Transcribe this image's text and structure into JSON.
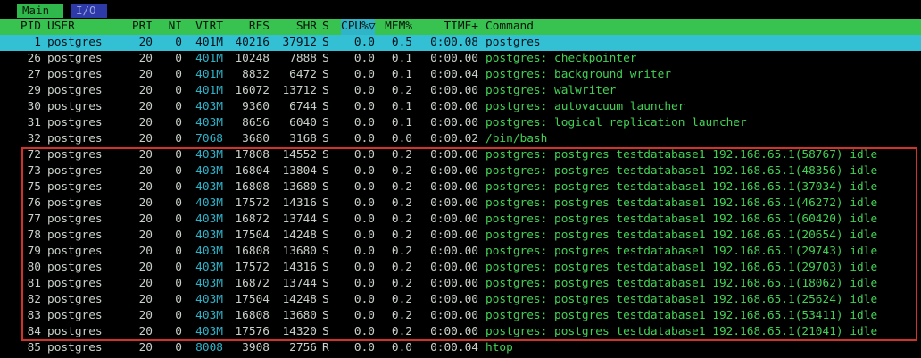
{
  "tabs": [
    {
      "label": "Main"
    },
    {
      "label": "I/O"
    }
  ],
  "header": {
    "pid": "PID",
    "user": "USER",
    "pri": "PRI",
    "ni": "NI",
    "virt": "VIRT",
    "res": "RES",
    "shr": "SHR",
    "s": "S",
    "cpu": "CPU%",
    "sort_marker": "▽",
    "mem": "MEM%",
    "time": "TIME+",
    "command": "Command"
  },
  "colors": {
    "header_bg": "#38c24f",
    "selected_bg": "#33bfd4",
    "highlight_border": "#d33228"
  },
  "processes": [
    {
      "pid": "1",
      "user": "postgres",
      "pri": "20",
      "ni": "0",
      "virt": "401M",
      "res": "40216",
      "shr": "37912",
      "s": "S",
      "cpu": "0.0",
      "mem": "0.5",
      "time": "0:00.08",
      "command": "postgres",
      "selected": true
    },
    {
      "pid": "26",
      "user": "postgres",
      "pri": "20",
      "ni": "0",
      "virt": "401M",
      "res": "10248",
      "shr": "7888",
      "s": "S",
      "cpu": "0.0",
      "mem": "0.1",
      "time": "0:00.00",
      "command": "postgres: checkpointer"
    },
    {
      "pid": "27",
      "user": "postgres",
      "pri": "20",
      "ni": "0",
      "virt": "401M",
      "res": "8832",
      "shr": "6472",
      "s": "S",
      "cpu": "0.0",
      "mem": "0.1",
      "time": "0:00.04",
      "command": "postgres: background writer"
    },
    {
      "pid": "29",
      "user": "postgres",
      "pri": "20",
      "ni": "0",
      "virt": "401M",
      "res": "16072",
      "shr": "13712",
      "s": "S",
      "cpu": "0.0",
      "mem": "0.2",
      "time": "0:00.00",
      "command": "postgres: walwriter"
    },
    {
      "pid": "30",
      "user": "postgres",
      "pri": "20",
      "ni": "0",
      "virt": "403M",
      "res": "9360",
      "shr": "6744",
      "s": "S",
      "cpu": "0.0",
      "mem": "0.1",
      "time": "0:00.00",
      "command": "postgres: autovacuum launcher"
    },
    {
      "pid": "31",
      "user": "postgres",
      "pri": "20",
      "ni": "0",
      "virt": "403M",
      "res": "8656",
      "shr": "6040",
      "s": "S",
      "cpu": "0.0",
      "mem": "0.1",
      "time": "0:00.00",
      "command": "postgres: logical replication launcher"
    },
    {
      "pid": "32",
      "user": "postgres",
      "pri": "20",
      "ni": "0",
      "virt": "7068",
      "res": "3680",
      "shr": "3168",
      "s": "S",
      "cpu": "0.0",
      "mem": "0.0",
      "time": "0:00.02",
      "command": "/bin/bash"
    },
    {
      "pid": "72",
      "user": "postgres",
      "pri": "20",
      "ni": "0",
      "virt": "403M",
      "res": "17808",
      "shr": "14552",
      "s": "S",
      "cpu": "0.0",
      "mem": "0.2",
      "time": "0:00.00",
      "command": "postgres: postgres testdatabase1 192.168.65.1(58767) idle"
    },
    {
      "pid": "73",
      "user": "postgres",
      "pri": "20",
      "ni": "0",
      "virt": "403M",
      "res": "16804",
      "shr": "13804",
      "s": "S",
      "cpu": "0.0",
      "mem": "0.2",
      "time": "0:00.00",
      "command": "postgres: postgres testdatabase1 192.168.65.1(48356) idle"
    },
    {
      "pid": "75",
      "user": "postgres",
      "pri": "20",
      "ni": "0",
      "virt": "403M",
      "res": "16808",
      "shr": "13680",
      "s": "S",
      "cpu": "0.0",
      "mem": "0.2",
      "time": "0:00.00",
      "command": "postgres: postgres testdatabase1 192.168.65.1(37034) idle"
    },
    {
      "pid": "76",
      "user": "postgres",
      "pri": "20",
      "ni": "0",
      "virt": "403M",
      "res": "17572",
      "shr": "14316",
      "s": "S",
      "cpu": "0.0",
      "mem": "0.2",
      "time": "0:00.00",
      "command": "postgres: postgres testdatabase1 192.168.65.1(46272) idle"
    },
    {
      "pid": "77",
      "user": "postgres",
      "pri": "20",
      "ni": "0",
      "virt": "403M",
      "res": "16872",
      "shr": "13744",
      "s": "S",
      "cpu": "0.0",
      "mem": "0.2",
      "time": "0:00.00",
      "command": "postgres: postgres testdatabase1 192.168.65.1(60420) idle"
    },
    {
      "pid": "78",
      "user": "postgres",
      "pri": "20",
      "ni": "0",
      "virt": "403M",
      "res": "17504",
      "shr": "14248",
      "s": "S",
      "cpu": "0.0",
      "mem": "0.2",
      "time": "0:00.00",
      "command": "postgres: postgres testdatabase1 192.168.65.1(20654) idle"
    },
    {
      "pid": "79",
      "user": "postgres",
      "pri": "20",
      "ni": "0",
      "virt": "403M",
      "res": "16808",
      "shr": "13680",
      "s": "S",
      "cpu": "0.0",
      "mem": "0.2",
      "time": "0:00.00",
      "command": "postgres: postgres testdatabase1 192.168.65.1(29743) idle"
    },
    {
      "pid": "80",
      "user": "postgres",
      "pri": "20",
      "ni": "0",
      "virt": "403M",
      "res": "17572",
      "shr": "14316",
      "s": "S",
      "cpu": "0.0",
      "mem": "0.2",
      "time": "0:00.00",
      "command": "postgres: postgres testdatabase1 192.168.65.1(29703) idle"
    },
    {
      "pid": "81",
      "user": "postgres",
      "pri": "20",
      "ni": "0",
      "virt": "403M",
      "res": "16872",
      "shr": "13744",
      "s": "S",
      "cpu": "0.0",
      "mem": "0.2",
      "time": "0:00.00",
      "command": "postgres: postgres testdatabase1 192.168.65.1(18062) idle"
    },
    {
      "pid": "82",
      "user": "postgres",
      "pri": "20",
      "ni": "0",
      "virt": "403M",
      "res": "17504",
      "shr": "14248",
      "s": "S",
      "cpu": "0.0",
      "mem": "0.2",
      "time": "0:00.00",
      "command": "postgres: postgres testdatabase1 192.168.65.1(25624) idle"
    },
    {
      "pid": "83",
      "user": "postgres",
      "pri": "20",
      "ni": "0",
      "virt": "403M",
      "res": "16808",
      "shr": "13680",
      "s": "S",
      "cpu": "0.0",
      "mem": "0.2",
      "time": "0:00.00",
      "command": "postgres: postgres testdatabase1 192.168.65.1(53411) idle"
    },
    {
      "pid": "84",
      "user": "postgres",
      "pri": "20",
      "ni": "0",
      "virt": "403M",
      "res": "17576",
      "shr": "14320",
      "s": "S",
      "cpu": "0.0",
      "mem": "0.2",
      "time": "0:00.00",
      "command": "postgres: postgres testdatabase1 192.168.65.1(21041) idle"
    },
    {
      "pid": "85",
      "user": "postgres",
      "pri": "20",
      "ni": "0",
      "virt": "8008",
      "res": "3908",
      "shr": "2756",
      "s": "R",
      "cpu": "0.0",
      "mem": "0.0",
      "time": "0:00.04",
      "command": "htop"
    }
  ]
}
